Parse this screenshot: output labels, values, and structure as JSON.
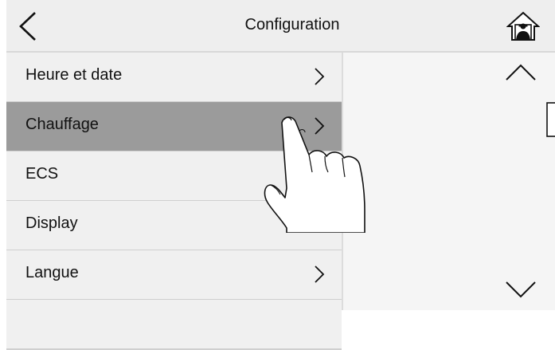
{
  "header": {
    "title": "Configuration",
    "back_icon": "chevron-left-icon",
    "home_icon": "home-person-icon"
  },
  "menu": {
    "items": [
      {
        "label": "Heure et date",
        "selected": false
      },
      {
        "label": "Chauffage",
        "selected": true
      },
      {
        "label": "ECS",
        "selected": false
      },
      {
        "label": "Display",
        "selected": false
      },
      {
        "label": "Langue",
        "selected": false
      }
    ]
  },
  "scroll": {
    "up_icon": "chevron-up-icon",
    "down_icon": "chevron-down-icon"
  },
  "colors": {
    "header_bg": "#eeeeee",
    "item_bg": "#f0f0f0",
    "selected_bg": "#9b9b9b",
    "divider": "#cfcfcf"
  }
}
